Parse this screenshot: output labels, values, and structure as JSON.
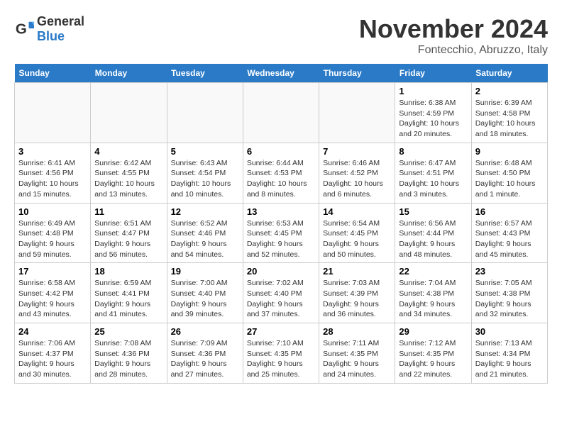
{
  "logo": {
    "text_general": "General",
    "text_blue": "Blue"
  },
  "title": "November 2024",
  "subtitle": "Fontecchio, Abruzzo, Italy",
  "headers": [
    "Sunday",
    "Monday",
    "Tuesday",
    "Wednesday",
    "Thursday",
    "Friday",
    "Saturday"
  ],
  "weeks": [
    [
      {
        "day": "",
        "info": ""
      },
      {
        "day": "",
        "info": ""
      },
      {
        "day": "",
        "info": ""
      },
      {
        "day": "",
        "info": ""
      },
      {
        "day": "",
        "info": ""
      },
      {
        "day": "1",
        "info": "Sunrise: 6:38 AM\nSunset: 4:59 PM\nDaylight: 10 hours and 20 minutes."
      },
      {
        "day": "2",
        "info": "Sunrise: 6:39 AM\nSunset: 4:58 PM\nDaylight: 10 hours and 18 minutes."
      }
    ],
    [
      {
        "day": "3",
        "info": "Sunrise: 6:41 AM\nSunset: 4:56 PM\nDaylight: 10 hours and 15 minutes."
      },
      {
        "day": "4",
        "info": "Sunrise: 6:42 AM\nSunset: 4:55 PM\nDaylight: 10 hours and 13 minutes."
      },
      {
        "day": "5",
        "info": "Sunrise: 6:43 AM\nSunset: 4:54 PM\nDaylight: 10 hours and 10 minutes."
      },
      {
        "day": "6",
        "info": "Sunrise: 6:44 AM\nSunset: 4:53 PM\nDaylight: 10 hours and 8 minutes."
      },
      {
        "day": "7",
        "info": "Sunrise: 6:46 AM\nSunset: 4:52 PM\nDaylight: 10 hours and 6 minutes."
      },
      {
        "day": "8",
        "info": "Sunrise: 6:47 AM\nSunset: 4:51 PM\nDaylight: 10 hours and 3 minutes."
      },
      {
        "day": "9",
        "info": "Sunrise: 6:48 AM\nSunset: 4:50 PM\nDaylight: 10 hours and 1 minute."
      }
    ],
    [
      {
        "day": "10",
        "info": "Sunrise: 6:49 AM\nSunset: 4:48 PM\nDaylight: 9 hours and 59 minutes."
      },
      {
        "day": "11",
        "info": "Sunrise: 6:51 AM\nSunset: 4:47 PM\nDaylight: 9 hours and 56 minutes."
      },
      {
        "day": "12",
        "info": "Sunrise: 6:52 AM\nSunset: 4:46 PM\nDaylight: 9 hours and 54 minutes."
      },
      {
        "day": "13",
        "info": "Sunrise: 6:53 AM\nSunset: 4:45 PM\nDaylight: 9 hours and 52 minutes."
      },
      {
        "day": "14",
        "info": "Sunrise: 6:54 AM\nSunset: 4:45 PM\nDaylight: 9 hours and 50 minutes."
      },
      {
        "day": "15",
        "info": "Sunrise: 6:56 AM\nSunset: 4:44 PM\nDaylight: 9 hours and 48 minutes."
      },
      {
        "day": "16",
        "info": "Sunrise: 6:57 AM\nSunset: 4:43 PM\nDaylight: 9 hours and 45 minutes."
      }
    ],
    [
      {
        "day": "17",
        "info": "Sunrise: 6:58 AM\nSunset: 4:42 PM\nDaylight: 9 hours and 43 minutes."
      },
      {
        "day": "18",
        "info": "Sunrise: 6:59 AM\nSunset: 4:41 PM\nDaylight: 9 hours and 41 minutes."
      },
      {
        "day": "19",
        "info": "Sunrise: 7:00 AM\nSunset: 4:40 PM\nDaylight: 9 hours and 39 minutes."
      },
      {
        "day": "20",
        "info": "Sunrise: 7:02 AM\nSunset: 4:40 PM\nDaylight: 9 hours and 37 minutes."
      },
      {
        "day": "21",
        "info": "Sunrise: 7:03 AM\nSunset: 4:39 PM\nDaylight: 9 hours and 36 minutes."
      },
      {
        "day": "22",
        "info": "Sunrise: 7:04 AM\nSunset: 4:38 PM\nDaylight: 9 hours and 34 minutes."
      },
      {
        "day": "23",
        "info": "Sunrise: 7:05 AM\nSunset: 4:38 PM\nDaylight: 9 hours and 32 minutes."
      }
    ],
    [
      {
        "day": "24",
        "info": "Sunrise: 7:06 AM\nSunset: 4:37 PM\nDaylight: 9 hours and 30 minutes."
      },
      {
        "day": "25",
        "info": "Sunrise: 7:08 AM\nSunset: 4:36 PM\nDaylight: 9 hours and 28 minutes."
      },
      {
        "day": "26",
        "info": "Sunrise: 7:09 AM\nSunset: 4:36 PM\nDaylight: 9 hours and 27 minutes."
      },
      {
        "day": "27",
        "info": "Sunrise: 7:10 AM\nSunset: 4:35 PM\nDaylight: 9 hours and 25 minutes."
      },
      {
        "day": "28",
        "info": "Sunrise: 7:11 AM\nSunset: 4:35 PM\nDaylight: 9 hours and 24 minutes."
      },
      {
        "day": "29",
        "info": "Sunrise: 7:12 AM\nSunset: 4:35 PM\nDaylight: 9 hours and 22 minutes."
      },
      {
        "day": "30",
        "info": "Sunrise: 7:13 AM\nSunset: 4:34 PM\nDaylight: 9 hours and 21 minutes."
      }
    ]
  ]
}
